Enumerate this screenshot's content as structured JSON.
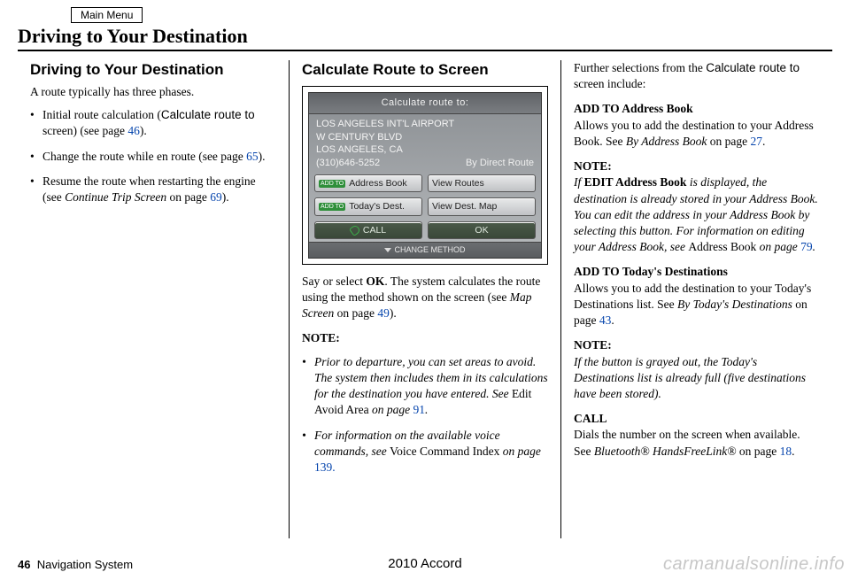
{
  "header": {
    "main_menu": "Main Menu",
    "page_title": "Driving to Your Destination"
  },
  "col1": {
    "h": "Driving to Your Destination",
    "intro": "A route typically has three phases.",
    "b1_a": "Initial route calculation (",
    "b1_term": "Calculate route to",
    "b1_b": " screen) (see page ",
    "b1_pg": "46",
    "b1_c": ").",
    "b2_a": "Change the route while en route (see page ",
    "b2_pg": "65",
    "b2_b": ").",
    "b3_a": "Resume the route when restarting the engine (see ",
    "b3_i": "Continue Trip Screen",
    "b3_b": " on page ",
    "b3_pg": "69",
    "b3_c": ")."
  },
  "col2": {
    "h": "Calculate Route to Screen",
    "screen": {
      "title": "Calculate route to:",
      "line1": "LOS ANGELES INT'L AIRPORT",
      "line2": "W CENTURY BLVD",
      "line3": "LOS ANGELES, CA",
      "phone": "(310)646-5252",
      "method": "By Direct Route",
      "btn_addto": "ADD TO",
      "btn_addr": "Address Book",
      "btn_view_routes": "View Routes",
      "btn_today": "Today's Dest.",
      "btn_view_map": "View Dest. Map",
      "btn_call": "CALL",
      "btn_ok": "OK",
      "footer": "CHANGE METHOD"
    },
    "p1_a": "Say or select ",
    "p1_ok": "OK",
    "p1_b": ". The system calculates the route using the method shown on the screen (see ",
    "p1_i": "Map Screen",
    "p1_c": " on page ",
    "p1_pg": "49",
    "p1_d": ").",
    "note_h": "NOTE:",
    "n1_a": "Prior to departure, you can set areas to avoid. The system then includes them in its calculations for the destination you have entered. See ",
    "n1_r": "Edit Avoid Area",
    "n1_b": " on page ",
    "n1_pg": "91",
    "n1_c": ".",
    "n2_a": "For information on the available voice commands, see ",
    "n2_r": "Voice Command Index",
    "n2_b": " on page ",
    "n2_pg": "139."
  },
  "col3": {
    "intro_a": "Further selections from the ",
    "intro_term": "Calculate route to",
    "intro_b": " screen include:",
    "h1": "ADD TO Address Book",
    "p1_a": "Allows you to add the destination to your Address Book. See ",
    "p1_i": "By Address Book",
    "p1_b": " on page ",
    "p1_pg": "27",
    "p1_c": ".",
    "note1_h": "NOTE:",
    "note1_a": "If ",
    "note1_bold": "EDIT Address Book",
    "note1_b": " is displayed, the destination is already stored in your Address Book. You can edit the address in your Address Book by selecting this button. For information on editing your Address Book, see ",
    "note1_r": "Address Book",
    "note1_c": " on page ",
    "note1_pg": "79",
    "note1_d": ".",
    "h2": "ADD TO Today's Destinations",
    "p2_a": "Allows you to add the destination to your Today's Destinations list. See ",
    "p2_i": "By Today's Destinations",
    "p2_b": " on page ",
    "p2_pg": "43",
    "p2_c": ".",
    "note2_h": "NOTE:",
    "note2_body": "If the button is grayed out, the Today's Destinations list is already full (five destinations have been stored).",
    "h3": "CALL",
    "p3_a": "Dials the number on the screen when available. See ",
    "p3_i": "Bluetooth® HandsFreeLink®",
    "p3_b": " on page ",
    "p3_pg": "18",
    "p3_c": "."
  },
  "footer": {
    "pgnum": "46",
    "label": "Navigation System",
    "model": "2010 Accord",
    "watermark": "carmanualsonline.info"
  }
}
